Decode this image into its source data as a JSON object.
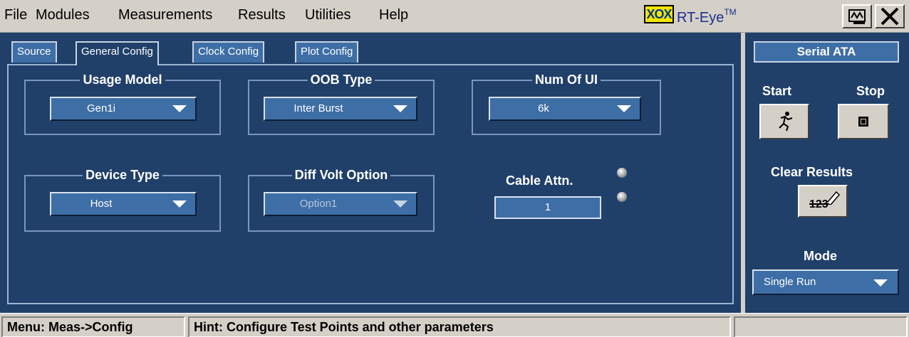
{
  "menu": [
    "File",
    "Modules",
    "Measurements",
    "Results",
    "Utilities",
    "Help"
  ],
  "app": {
    "logo": "XOX",
    "title": "RT-Eye",
    "trademark": "TM"
  },
  "tabs": [
    "Source",
    "General Config",
    "Clock Config",
    "Plot Config"
  ],
  "config": {
    "usage_model": {
      "label": "Usage Model",
      "value": "Gen1i"
    },
    "oob_type": {
      "label": "OOB Type",
      "value": "Inter Burst"
    },
    "num_ui": {
      "label": "Num Of UI",
      "value": "6k"
    },
    "device_type": {
      "label": "Device Type",
      "value": "Host"
    },
    "diff_volt": {
      "label": "Diff Volt Option",
      "value": "Option1"
    },
    "cable_attn": {
      "label": "Cable Attn.",
      "value": "1"
    }
  },
  "right_panel": {
    "title": "Serial ATA",
    "start_label": "Start",
    "stop_label": "Stop",
    "clear_label": "Clear Results",
    "clear_icon_text": "123",
    "mode_label": "Mode",
    "mode_value": "Single Run"
  },
  "status": {
    "menu": "Menu: Meas->Config",
    "hint": "Hint: Configure Test Points and other parameters"
  },
  "colors": {
    "panel_bg": "#20406a",
    "control_bg": "#3e6ea6",
    "chrome": "#d4d0c8"
  }
}
